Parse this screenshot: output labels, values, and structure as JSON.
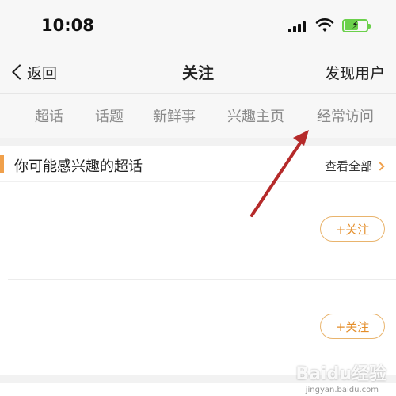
{
  "status_bar": {
    "time": "10:08"
  },
  "navbar": {
    "back_label": "返回",
    "title": "关注",
    "right_action": "发现用户"
  },
  "tabs": [
    {
      "label": "超话"
    },
    {
      "label": "话题"
    },
    {
      "label": "新鲜事"
    },
    {
      "label": "兴趣主页"
    },
    {
      "label": "经常访问"
    }
  ],
  "section": {
    "title": "你可能感兴趣的超话",
    "see_all": "查看全部",
    "rows": [
      {
        "follow_label": "+关注"
      },
      {
        "follow_label": "+关注"
      }
    ]
  },
  "watermark": {
    "text": "Baidu经验",
    "sub": "jingyan.baidu.com"
  },
  "colors": {
    "accent": "#f0a04b",
    "follow_text": "#e48e2a",
    "annotation_arrow": "#b52a2a"
  }
}
